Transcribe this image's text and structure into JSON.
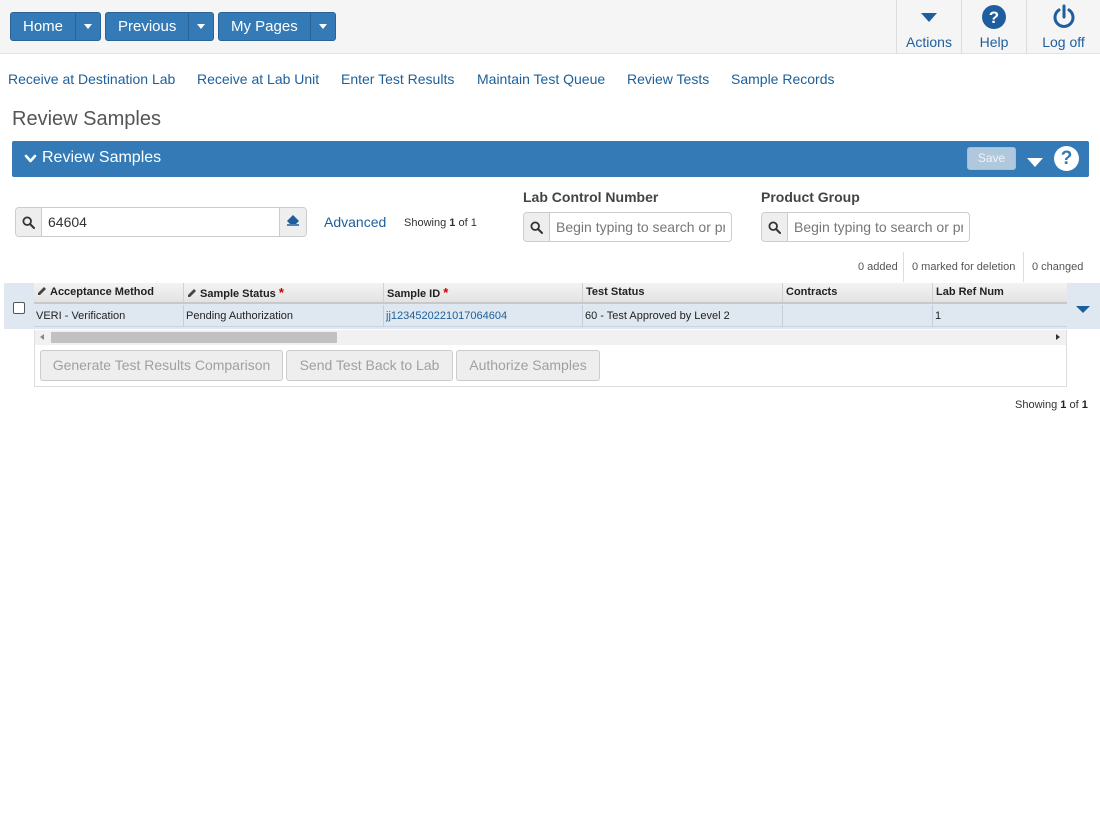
{
  "topbar": {
    "home_label": "Home",
    "previous_label": "Previous",
    "mypages_label": "My Pages",
    "actions_label": "Actions",
    "help_label": "Help",
    "logoff_label": "Log off"
  },
  "links": [
    "Receive at Destination Lab",
    "Receive at Lab Unit",
    "Enter Test Results",
    "Maintain Test Queue",
    "Review Tests",
    "Sample Records"
  ],
  "page_title": "Review Samples",
  "panel": {
    "title": "Review Samples",
    "save_label": "Save"
  },
  "search": {
    "value": "64604",
    "advanced_label": "Advanced",
    "showing_prefix": "Showing",
    "showing_from": "1",
    "showing_of": "of",
    "showing_total": "1"
  },
  "filters": {
    "lab_control_label": "Lab Control Number",
    "lab_control_placeholder": "Begin typing to search or press",
    "product_group_label": "Product Group",
    "product_group_placeholder": "Begin typing to search or press"
  },
  "counts": {
    "added": "0 added",
    "deleted": "0 marked for deletion",
    "changed": "0 changed"
  },
  "grid": {
    "columns": [
      "Acceptance Method",
      "Sample Status",
      "Sample ID",
      "Test Status",
      "Contracts",
      "Lab Ref Num"
    ],
    "rows": [
      {
        "acceptance_method": "VERI - Verification",
        "sample_status": "Pending Authorization",
        "sample_id": "jj1234520221017064604",
        "test_status": "60 - Test Approved by Level 2",
        "contracts": "",
        "lab_ref_num": "1"
      }
    ]
  },
  "buttons": {
    "generate": "Generate Test Results Comparison",
    "send_back": "Send Test Back to Lab",
    "authorize": "Authorize Samples"
  },
  "footer": {
    "showing_prefix": "Showing",
    "showing_from": "1",
    "showing_of": "of",
    "showing_total": "1"
  },
  "colors": {
    "primary": "#337ab7",
    "link": "#1d5f9a",
    "row_selected": "#dfe8f1",
    "required": "#cc0000"
  },
  "icons": [
    "caret-down-icon",
    "help-icon",
    "power-icon",
    "search-icon",
    "eraser-icon",
    "chevron-down-icon",
    "pencil-icon",
    "required-asterisk-icon"
  ]
}
